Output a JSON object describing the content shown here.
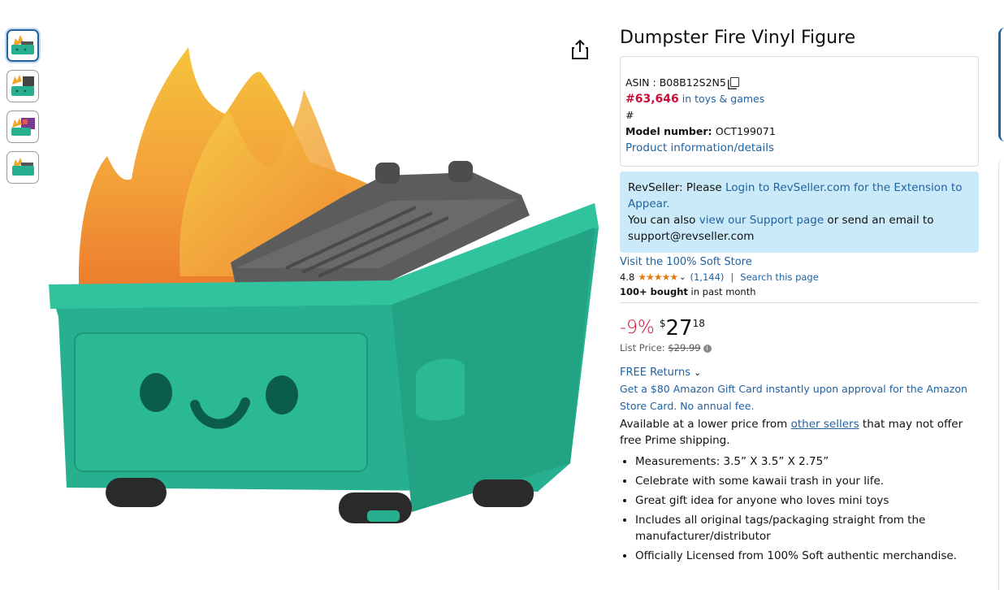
{
  "thumbnails": [
    {
      "icon": "dumpster-thumb-front",
      "active": true
    },
    {
      "icon": "dumpster-thumb-box",
      "active": false
    },
    {
      "icon": "dumpster-thumb-lifestyle",
      "active": false
    },
    {
      "icon": "dumpster-thumb-side",
      "active": false
    }
  ],
  "product": {
    "title": "Dumpster Fire Vinyl Figure",
    "asin_label": "ASIN : ",
    "asin": "B08B12S2N5",
    "rank": "#63,646",
    "rank_category": "in toys & games",
    "hash": "#",
    "model_label": "Model number: ",
    "model": "OCT199071",
    "details_link": "Product information/details"
  },
  "revseller": {
    "prefix": "RevSeller: Please ",
    "login_link": "Login to RevSeller.com for the Extension to Appear.",
    "also": "You can also ",
    "support_link": "view our Support page",
    "email_text": " or send an email to support@revseller.com"
  },
  "store_link": "Visit the 100% Soft Store",
  "rating": {
    "value": "4.8",
    "stars": "★★★★★",
    "count": "(1,144)",
    "separator": "|",
    "search_link": "Search this page"
  },
  "bought": {
    "bold": "100+ bought",
    "rest": " in past month"
  },
  "price": {
    "discount": "-9%",
    "currency": "$",
    "whole": "27",
    "fraction": "18",
    "list_label": "List Price: ",
    "list_value": "$29.99"
  },
  "returns": "FREE Returns",
  "gift_card": "Get a $80 Amazon Gift Card instantly upon approval for the Amazon Store Card. No annual fee.",
  "availability": {
    "prefix": "Available at a lower price from ",
    "link": "other sellers",
    "suffix": " that may not offer free Prime shipping."
  },
  "bullets": [
    "Measurements: 3.5” X 3.5” X 2.75”",
    "Celebrate with some kawaii trash in your life.",
    "Great gift idea for anyone who loves mini toys",
    "Includes all original tags/packaging straight from the manufacturer/distributor",
    "Officially Licensed from 100% Soft authentic merchandise."
  ],
  "colors": {
    "link": "#2162a1",
    "deal": "#cc0c39",
    "revseller_bg": "#cbeaf9",
    "dumpster": "#27b08f",
    "star": "#e47911"
  }
}
